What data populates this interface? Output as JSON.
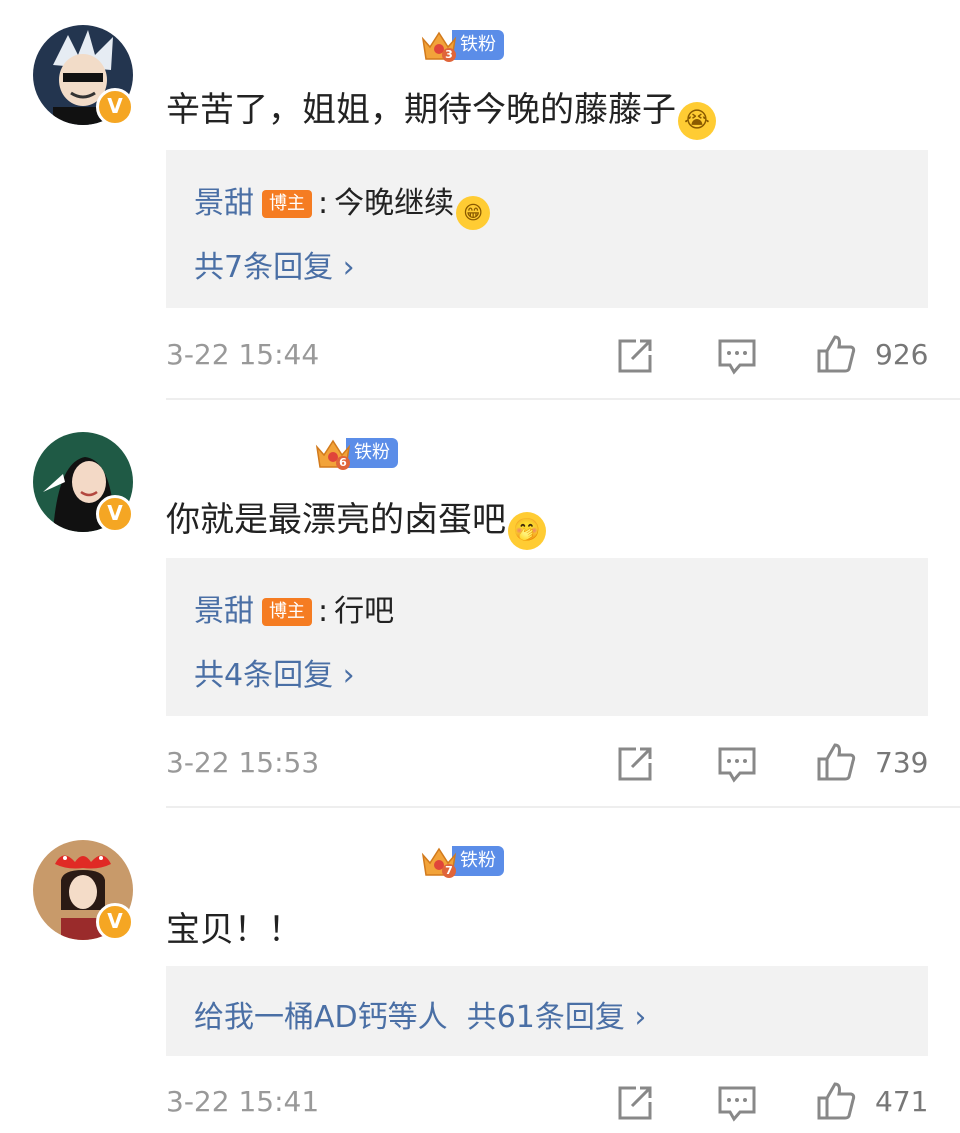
{
  "comments": [
    {
      "fan_badge": "铁粉",
      "fan_level": "3",
      "text": "辛苦了，姐姐，期待今晚的藤藤子",
      "reply": {
        "author": "景甜",
        "tag": "博主",
        "separator": ":",
        "content": "今晚继续"
      },
      "more_replies": "共7条回复 ›",
      "time": "3-22 15:44",
      "likes": "926"
    },
    {
      "fan_badge": "铁粉",
      "fan_level": "6",
      "text": "你就是最漂亮的卤蛋吧",
      "reply": {
        "author": "景甜",
        "tag": "博主",
        "separator": ":",
        "content": "行吧"
      },
      "more_replies": "共4条回复 ›",
      "time": "3-22 15:53",
      "likes": "739"
    },
    {
      "fan_badge": "铁粉",
      "fan_level": "7",
      "text": "宝贝！！",
      "reply_summary": "给我一桶AD钙等人  共61条回复 ›",
      "time": "3-22 15:41",
      "likes": "471"
    }
  ],
  "icons": {
    "share": "share-icon",
    "comment": "comment-icon",
    "like": "like-icon",
    "verified": "verified-badge-icon",
    "crown": "crown-icon"
  },
  "colors": {
    "link_blue": "#4a6fa5",
    "fan_badge_blue": "#5b8de8",
    "blogger_orange": "#f57c22",
    "verified_gold": "#f5a623",
    "reply_bg": "#f2f2f2"
  }
}
